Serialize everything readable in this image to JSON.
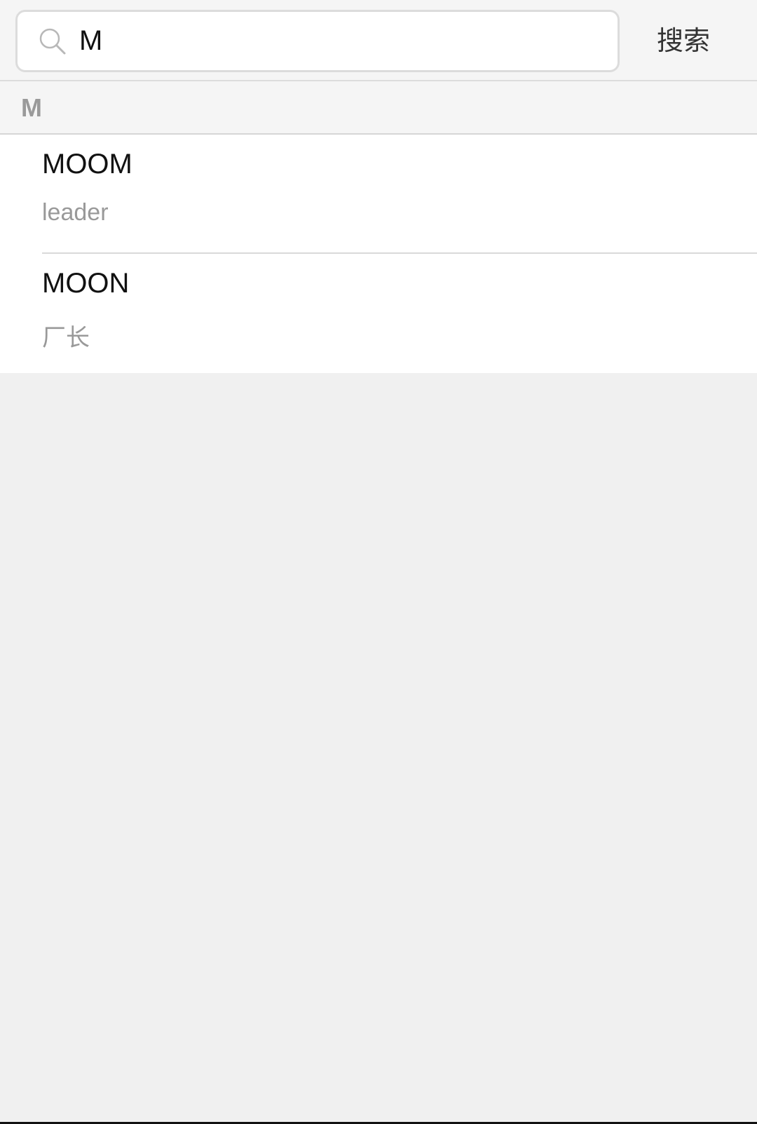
{
  "search": {
    "value": "M",
    "button_label": "搜索"
  },
  "results": {
    "section_letter": "M",
    "items": [
      {
        "name": "MOOM",
        "subtitle": "leader"
      },
      {
        "name": "MOON",
        "subtitle": "厂长"
      }
    ]
  }
}
